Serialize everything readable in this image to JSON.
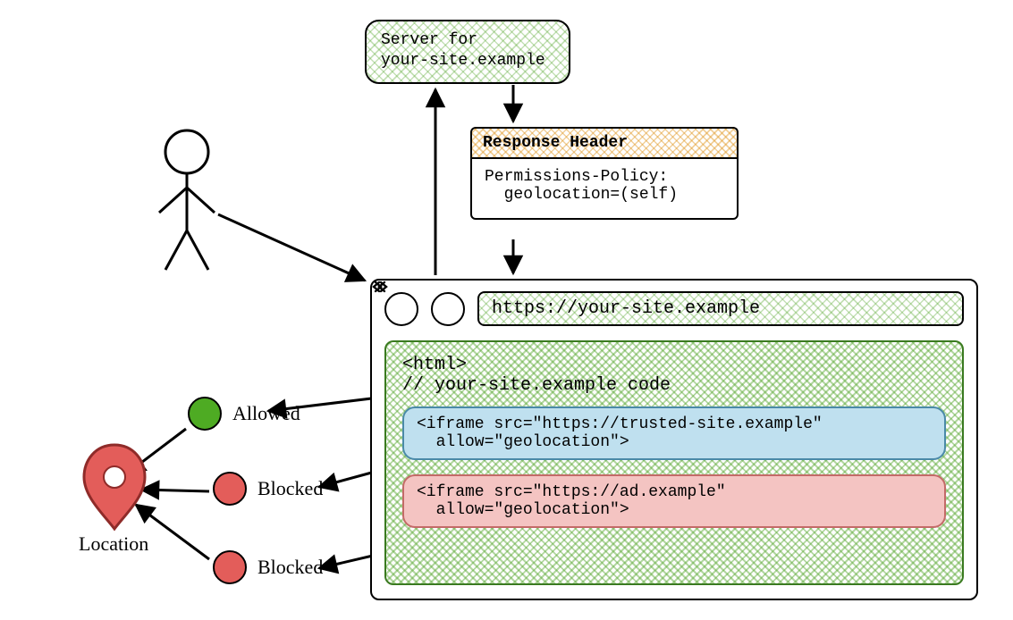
{
  "server": {
    "line1": "Server for",
    "line2": "your-site.example"
  },
  "response": {
    "title": "Response Header",
    "line1": "Permissions-Policy:",
    "line2": "  geolocation=(self)"
  },
  "browser": {
    "url": "https://your-site.example",
    "html_open": "<html>",
    "own_code_comment": "// your-site.example code",
    "iframe_trusted": {
      "line1": "<iframe src=\"https://trusted-site.example\"",
      "line2": "  allow=\"geolocation\">"
    },
    "iframe_ad": {
      "line1": "<iframe src=\"https://ad.example\"",
      "line2": "  allow=\"geolocation\">"
    }
  },
  "status": {
    "allowed": "Allowed",
    "blocked_trusted": "Blocked",
    "blocked_ad": "Blocked"
  },
  "location_label": "Location"
}
